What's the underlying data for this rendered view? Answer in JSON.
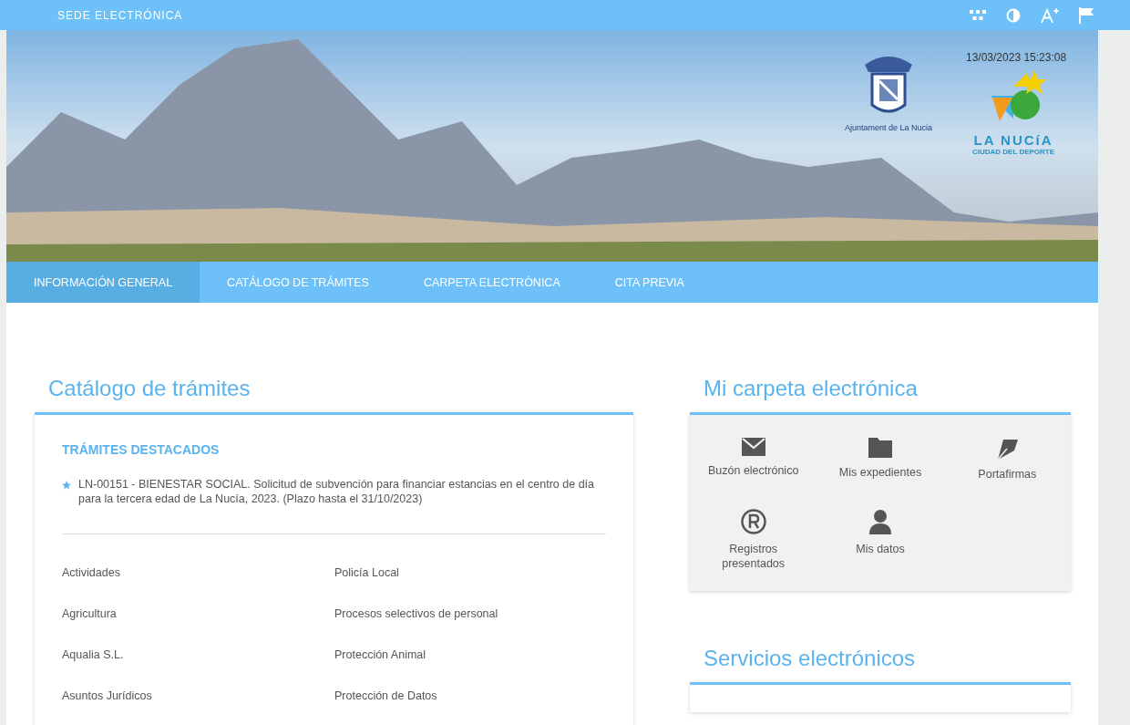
{
  "top_bar": {
    "title": "SEDE ELECTRÓNICA"
  },
  "banner": {
    "datetime": "13/03/2023 15:23:08",
    "council_logo_caption": "Ajuntament de La Nucia",
    "town_logo_name": "LA NUCíA",
    "town_logo_slogan": "CIUDAD DEL DEPORTE"
  },
  "nav": [
    {
      "label": "INFORMACIÓN GENERAL",
      "selected": true
    },
    {
      "label": "CATÁLOGO DE TRÁMITES",
      "selected": false
    },
    {
      "label": "CARPETA ELECTRÓNICA",
      "selected": false
    },
    {
      "label": "CITA PREVIA",
      "selected": false
    }
  ],
  "catalog": {
    "title": "Catálogo de trámites",
    "featured_heading": "TRÁMITES DESTACADOS",
    "featured": [
      "LN-00151 - BIENESTAR SOCIAL. Solicitud de subvención para financiar estancias en el centro de día para la tercera edad de La Nucía, 2023. (Plazo hasta el 31/10/2023)"
    ],
    "categories": [
      "Actividades",
      "Policía Local",
      "Agricultura",
      "Procesos selectivos de personal",
      "Aqualia S.L.",
      "Protección Animal",
      "Asuntos Jurídicos",
      "Protección de Datos"
    ]
  },
  "folder": {
    "title": "Mi carpeta electrónica",
    "items": [
      {
        "label": "Buzón electrónico",
        "kind": "mail"
      },
      {
        "label": "Mis expedientes",
        "kind": "folder"
      },
      {
        "label": "Portafirmas",
        "kind": "pen"
      },
      {
        "label": "Registros presentados",
        "kind": "registered"
      },
      {
        "label": "Mis datos",
        "kind": "user"
      }
    ]
  },
  "services": {
    "title": "Servicios electrónicos"
  }
}
